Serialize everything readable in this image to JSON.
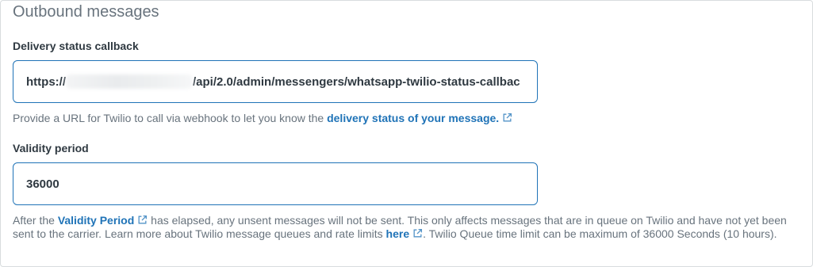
{
  "section": {
    "title": "Outbound messages"
  },
  "callback": {
    "label": "Delivery status callback",
    "value_prefix": "https://",
    "value_suffix": "/api/2.0/admin/messengers/whatsapp-twilio-status-callbac",
    "hint_text": "Provide a URL for Twilio to call via webhook to let you know the ",
    "hint_link": "delivery status of your message."
  },
  "validity": {
    "label": "Validity period",
    "value": "36000",
    "hint_part1": "After the ",
    "hint_link1": "Validity Period",
    "hint_part2": " has elapsed, any unsent messages will not be sent. This only affects messages that are in queue on Twilio and have not yet been sent to the carrier. Learn more about Twilio message queues and rate limits ",
    "hint_link2": "here",
    "hint_part3": ". Twilio Queue time limit can be maximum of 36000 Seconds (10 hours)."
  },
  "icons": {
    "external_link": "external-link-icon"
  },
  "colors": {
    "link": "#1f73b7",
    "input_border": "#1f73b7",
    "muted_text": "#68737d"
  }
}
